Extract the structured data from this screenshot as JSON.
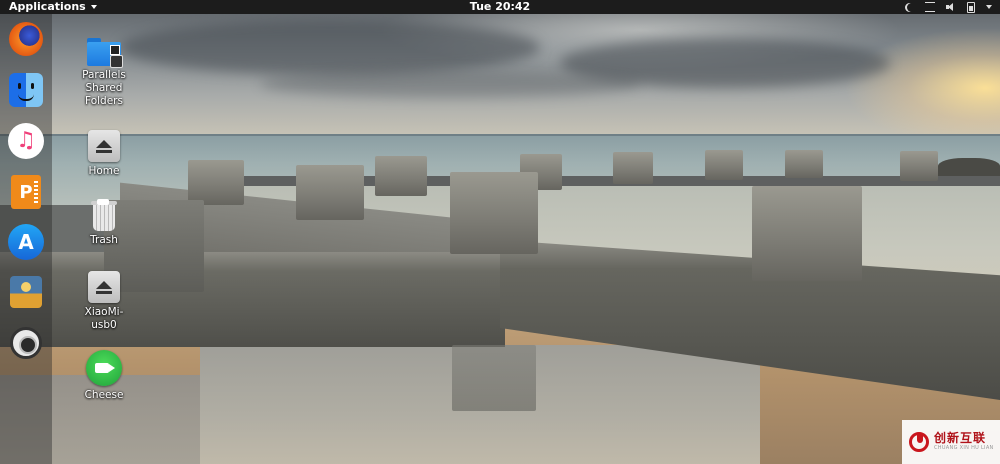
{
  "topbar": {
    "applications_label": "Applications",
    "clock": "Tue 20:42"
  },
  "dock": {
    "items": [
      {
        "name": "Firefox",
        "icon": "firefox-icon"
      },
      {
        "name": "Finder",
        "icon": "finder-icon"
      },
      {
        "name": "Music",
        "icon": "music-icon",
        "glyph": "♫"
      },
      {
        "name": "Pages",
        "icon": "pages-icon",
        "glyph": "P"
      },
      {
        "name": "App Store",
        "icon": "app-store-icon",
        "glyph": "A"
      },
      {
        "name": "Installer",
        "icon": "installer-icon"
      },
      {
        "name": "Help",
        "icon": "lifebuoy-icon"
      }
    ]
  },
  "desktop": {
    "items": [
      {
        "label": "Parallels\nShared\nFolders",
        "icon": "shared-folder-icon"
      },
      {
        "label": "Home",
        "icon": "eject-icon"
      },
      {
        "label": "Trash",
        "icon": "trash-icon"
      },
      {
        "label": "XiaoMi-\nusb0",
        "icon": "eject-icon"
      },
      {
        "label": "Cheese",
        "icon": "cheese-camera-icon"
      }
    ]
  },
  "watermark": {
    "main": "创新互联",
    "sub": "CHUANG XIN HU LIAN"
  }
}
